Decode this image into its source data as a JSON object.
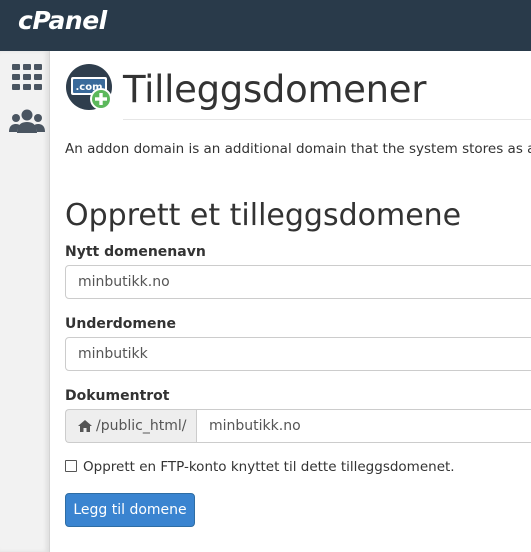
{
  "brand": {
    "logo_text": "cPanel"
  },
  "sidebar": {
    "items": [
      {
        "icon": "grid-icon"
      },
      {
        "icon": "users-icon"
      }
    ]
  },
  "page": {
    "title": "Tilleggsdomener",
    "icon": "com-domain-add-icon",
    "icon_text": ".com",
    "description": "An addon domain is an additional domain that the system stores as a su"
  },
  "form": {
    "section_title": "Opprett et tilleggsdomene",
    "new_domain": {
      "label": "Nytt domenenavn",
      "value": "minbutikk.no"
    },
    "subdomain": {
      "label": "Underdomene",
      "value": "minbutikk"
    },
    "document_root": {
      "label": "Dokumentrot",
      "prefix": "/public_html/",
      "value": "minbutikk.no"
    },
    "ftp_checkbox": {
      "label": "Opprett en FTP-konto knyttet til dette tilleggsdomenet.",
      "checked": false
    },
    "submit_label": "Legg til domene"
  },
  "colors": {
    "topbar": "#293a4a",
    "button": "#3a84d0",
    "plus_badge": "#5cb85c"
  }
}
